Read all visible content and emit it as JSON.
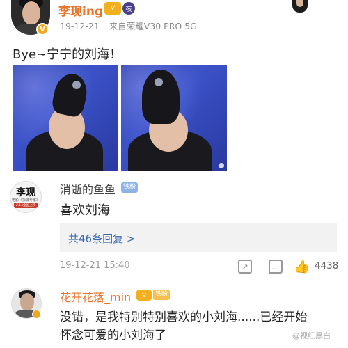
{
  "post": {
    "author": "李现ing",
    "vip_mark": "V",
    "badge_level": "V",
    "badge_night": "夜",
    "date": "19-12-21",
    "source_prefix": "来自",
    "device": "荣耀V30 PRO 5G",
    "text": "Bye~宁宁的刘海！"
  },
  "comments": [
    {
      "avatar_text_main": "李现",
      "avatar_text_sub": "电影《拆弹专家》",
      "avatar_text_date": "2.14全国上映",
      "author": "消逝的鱼鱼",
      "badge": "铁粉",
      "text": "喜欢刘海",
      "reply_link": "共46条回复 >",
      "time": "19-12-21 15:40",
      "like_count": "4438"
    },
    {
      "author": "花开花落_min",
      "badge_level": "V",
      "badge": "铁粉",
      "text": "没错，是我特别特别喜欢的小刘海......已经开始怀念可爱的小刘海了"
    }
  ],
  "watermark": "@视红黑白",
  "icons": {
    "share": "share-icon",
    "comment": "comment-icon",
    "like": "thumbs-up-icon"
  },
  "colors": {
    "username_orange": "#e8742c",
    "link_blue": "#3d6bb1",
    "photo_blue": "#3b52c8"
  }
}
